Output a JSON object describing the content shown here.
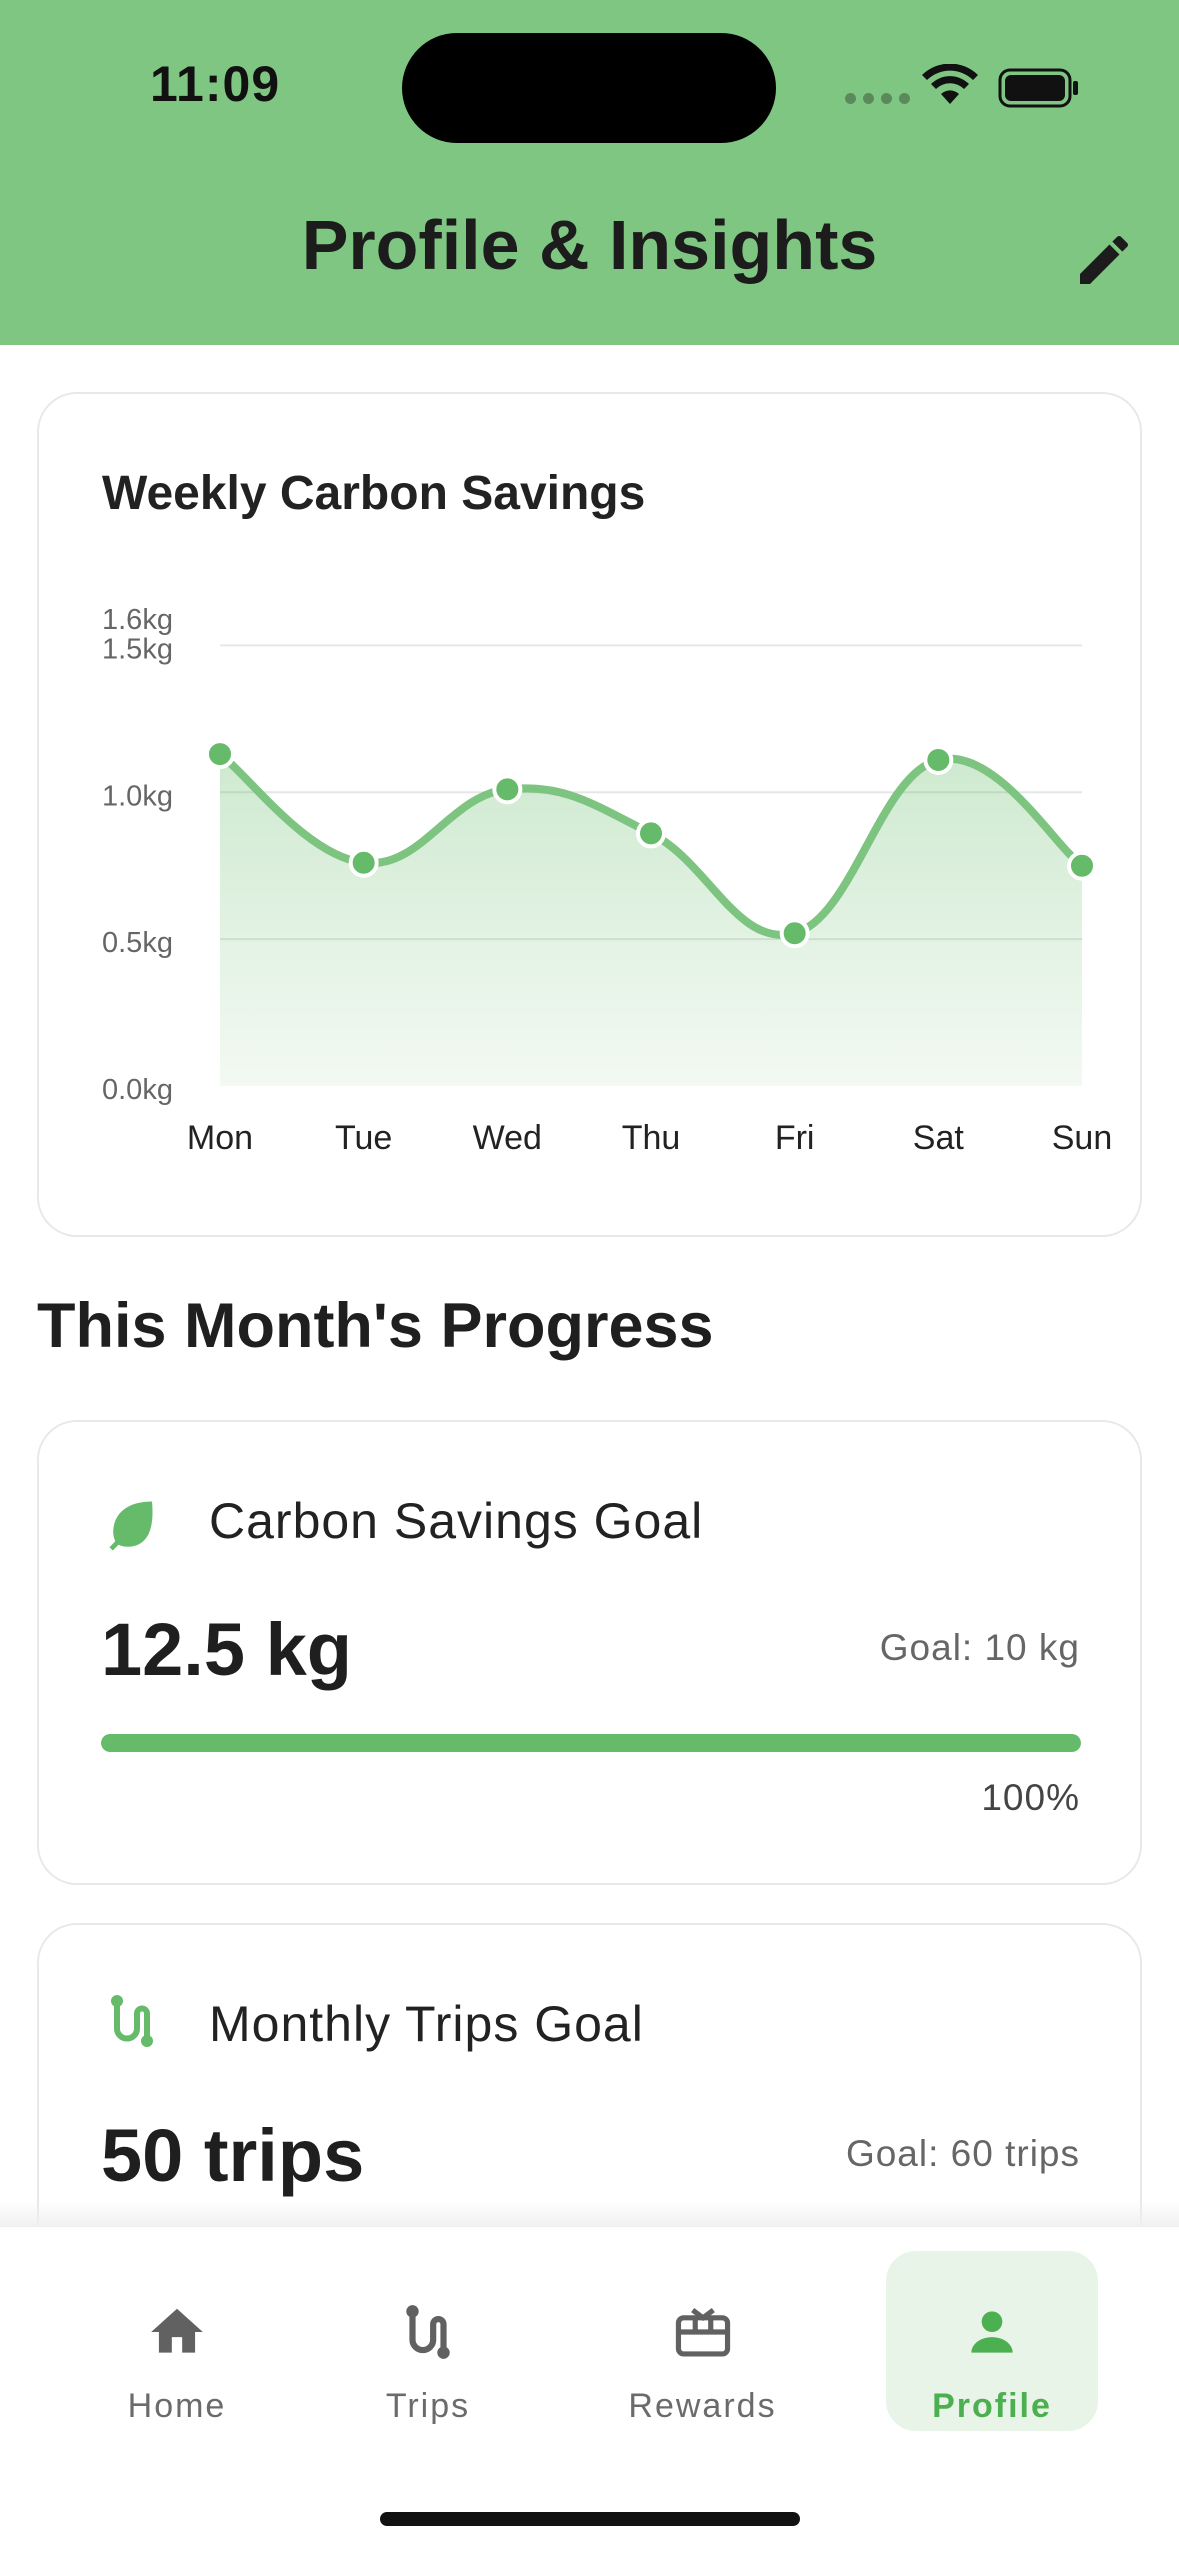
{
  "status_bar": {
    "time": "11:09"
  },
  "header": {
    "title": "Profile & Insights",
    "edit_icon": "pencil-icon"
  },
  "chart_card": {
    "chart_data": {
      "type": "area",
      "title": "Weekly Carbon Savings",
      "categories": [
        "Mon",
        "Tue",
        "Wed",
        "Thu",
        "Fri",
        "Sat",
        "Sun"
      ],
      "values": [
        1.13,
        0.76,
        1.01,
        0.86,
        0.52,
        1.11,
        0.75
      ],
      "y_ticks": [
        "0.0kg",
        "0.5kg",
        "1.0kg",
        "1.5kg",
        "1.6kg"
      ],
      "y_tick_values": [
        0,
        0.5,
        1.0,
        1.5,
        1.6
      ],
      "ylim": [
        0,
        1.5
      ],
      "grid": true,
      "color": "#66bb6a"
    }
  },
  "section_title": "This Month's Progress",
  "goals": [
    {
      "icon": "leaf-icon",
      "title": "Carbon Savings Goal",
      "value": "12.5 kg",
      "target": "Goal: 10 kg",
      "progress": 1.0,
      "progress_label": "100%"
    },
    {
      "icon": "route-icon",
      "title": "Monthly Trips Goal",
      "value": "50 trips",
      "target": "Goal: 60 trips"
    }
  ],
  "nav": {
    "items": [
      {
        "label": "Home",
        "icon": "home-icon"
      },
      {
        "label": "Trips",
        "icon": "route-icon"
      },
      {
        "label": "Rewards",
        "icon": "gift-card-icon"
      },
      {
        "label": "Profile",
        "icon": "person-icon"
      }
    ],
    "active": "Profile"
  },
  "colors": {
    "header": "#80c683",
    "accent": "#66bb6a",
    "active_nav_bg": "#e8f4e8"
  }
}
